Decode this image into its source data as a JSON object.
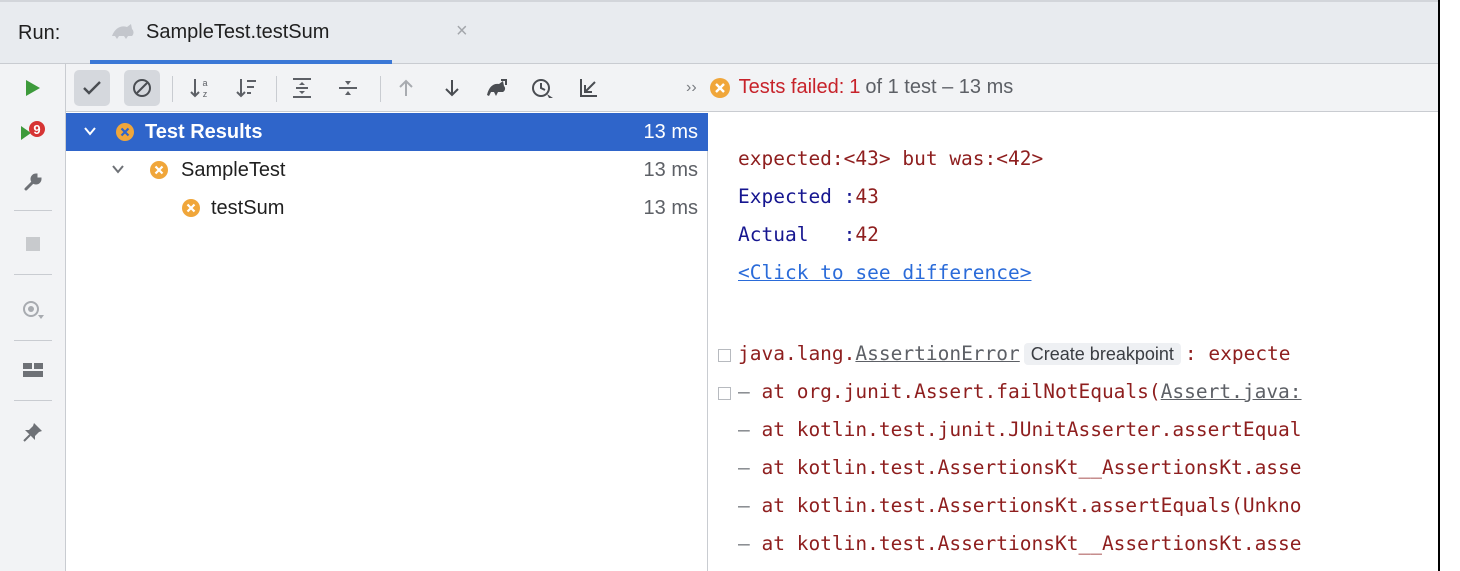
{
  "tabbar": {
    "run_label": "Run:",
    "tab_title": "SampleTest.testSum",
    "tab_close": "×"
  },
  "toolbar": {
    "status": {
      "chevron": "››",
      "fail_word": "Tests failed:",
      "fail_count": "1",
      "rest": "of 1 test – 13 ms"
    },
    "buttons": [
      {
        "name": "show-passed-button",
        "icon": "check-icon",
        "active": true
      },
      {
        "name": "show-ignored-button",
        "icon": "no-entry-icon",
        "active": true
      },
      {
        "name": "sort-alphabetically-button",
        "icon": "sort-az-icon"
      },
      {
        "name": "sort-by-duration-button",
        "icon": "sort-duration-icon"
      },
      {
        "name": "expand-all-button",
        "icon": "expand-all-icon"
      },
      {
        "name": "collapse-all-button",
        "icon": "collapse-all-icon"
      },
      {
        "name": "previous-failed-test-button",
        "icon": "arrow-up-icon"
      },
      {
        "name": "next-failed-test-button",
        "icon": "arrow-down-icon"
      },
      {
        "name": "import-tests-button",
        "icon": "tests-icon"
      },
      {
        "name": "test-history-button",
        "icon": "history-icon"
      },
      {
        "name": "export-results-button",
        "icon": "export-icon"
      }
    ]
  },
  "leftstrip": {
    "buttons": [
      {
        "name": "rerun-button",
        "icon": "play-icon"
      },
      {
        "name": "rerun-failed-tests-button",
        "icon": "rerun-failed-icon"
      },
      {
        "name": "settings-button",
        "icon": "wrench-icon"
      },
      {
        "name": "stop-button",
        "icon": "stop-icon"
      },
      {
        "name": "view-options-button",
        "icon": "eye-icon"
      },
      {
        "name": "layout-button",
        "icon": "layout-icon"
      },
      {
        "name": "pin-tab-button",
        "icon": "pin-icon"
      }
    ]
  },
  "tree": {
    "rows": [
      {
        "name": "Test Results",
        "time": "13 ms",
        "selected": true
      },
      {
        "name": "SampleTest",
        "time": "13 ms"
      },
      {
        "name": "testSum",
        "time": "13 ms"
      }
    ]
  },
  "console": {
    "expected_line": "expected:<43> but was:<42>",
    "expected_label": "Expected :",
    "expected_value": "43",
    "actual_label": "Actual   :",
    "actual_value": "42",
    "diff_link": "<Click to see difference>",
    "exception_prefix": "java.lang.",
    "exception_class": "AssertionError",
    "create_breakpoint": "Create breakpoint",
    "exception_suffix": ": expecte",
    "trace": [
      {
        "prefix": "at org.junit.Assert.failNotEquals(",
        "link": "Assert.java:"
      },
      {
        "prefix": "at kotlin.test.junit.JUnitAsserter.assertEqual"
      },
      {
        "prefix": "at kotlin.test.AssertionsKt__AssertionsKt.asse"
      },
      {
        "prefix": "at kotlin.test.AssertionsKt.assertEquals(Unkno"
      },
      {
        "prefix": "at kotlin.test.AssertionsKt__AssertionsKt.asse"
      }
    ]
  },
  "colors": {
    "selection": "#2f65ca",
    "fail_red": "#c7222a",
    "fail_orange": "#f0a63a",
    "run_green": "#3d9a3b",
    "console_red": "#8e1e1e",
    "console_navy": "#161690",
    "link_blue": "#2a6bd9"
  }
}
